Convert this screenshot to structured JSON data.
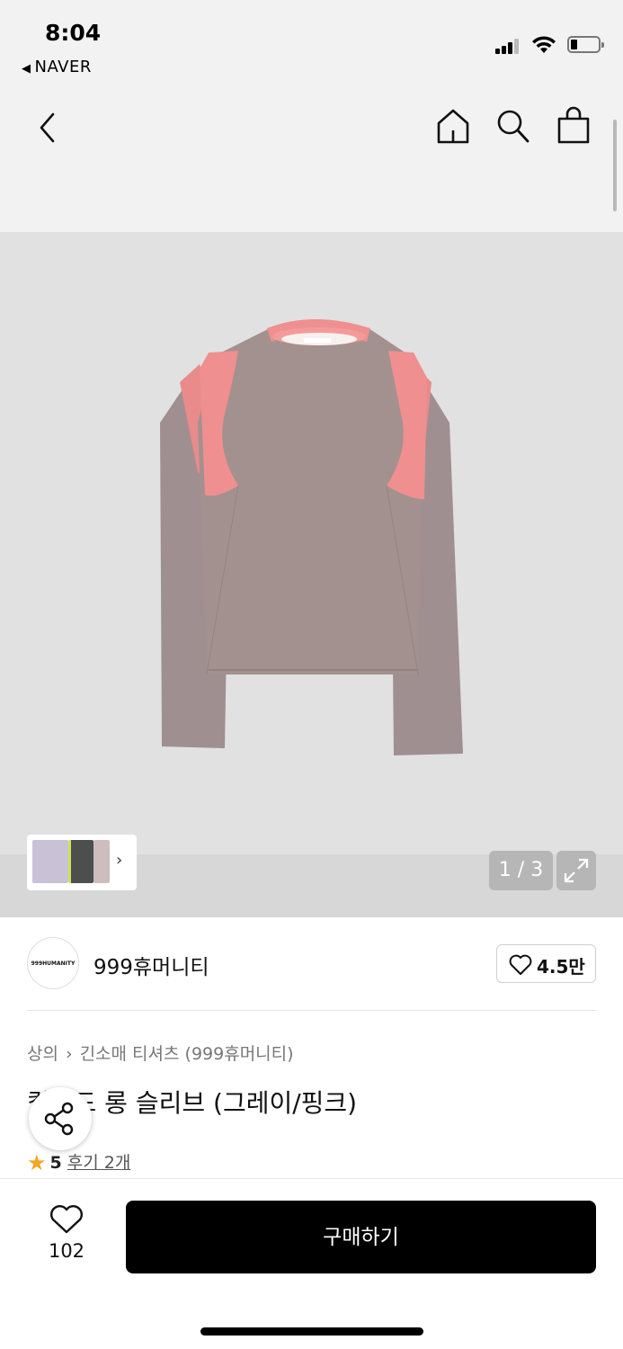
{
  "status": {
    "time": "8:04",
    "back_app": "NAVER"
  },
  "nav": {
    "icons": [
      "back-arrow-icon",
      "home-icon",
      "search-icon",
      "shopping-bag-icon"
    ]
  },
  "gallery": {
    "counter": "1 / 3",
    "thumbnail_arrow": "›",
    "colors": {
      "body": "#a08f90",
      "accent": "#ef8f8f",
      "background": "#e1e1e1"
    }
  },
  "brand": {
    "logo_text": "999HUMANITY",
    "name": "999휴머니티",
    "likes": "4.5만"
  },
  "product": {
    "breadcrumb": [
      "상의",
      "긴소매 티셔츠 (999휴머니티)"
    ],
    "title": "컬러드 롱 슬리브 (그레이/핑크)",
    "rating": "5",
    "reviews": "후기 2개"
  },
  "bottom": {
    "wish_count": "102",
    "buy_label": "구매하기"
  }
}
